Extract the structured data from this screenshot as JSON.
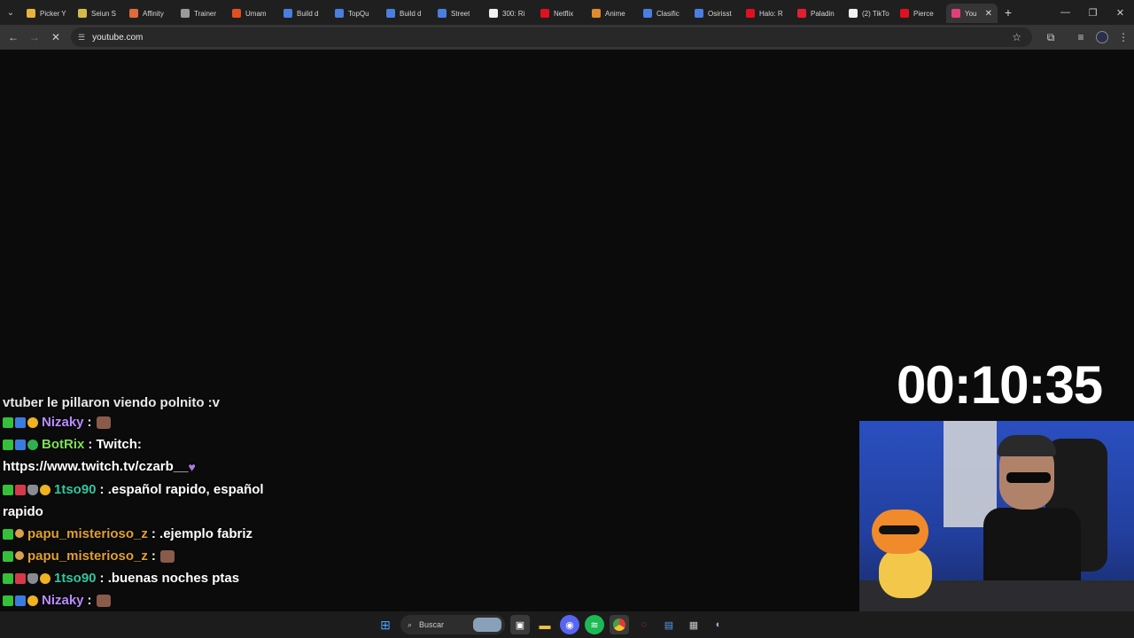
{
  "browser": {
    "tabs": [
      {
        "title": "Picker Y",
        "favicon_color": "#e9b23a"
      },
      {
        "title": "Seiun S",
        "favicon_color": "#d8b84a"
      },
      {
        "title": "Affinity",
        "favicon_color": "#e06a3a"
      },
      {
        "title": "Trainer",
        "favicon_color": "#9a9a9a"
      },
      {
        "title": "Umam",
        "favicon_color": "#e05020"
      },
      {
        "title": "Build d",
        "favicon_color": "#4a7ee0"
      },
      {
        "title": "TopQu",
        "favicon_color": "#4a7ee0"
      },
      {
        "title": "Build d",
        "favicon_color": "#4a7ee0"
      },
      {
        "title": "Street",
        "favicon_color": "#4a7ee0"
      },
      {
        "title": "300: Ri",
        "favicon_color": "#f0f0f0"
      },
      {
        "title": "Netflix",
        "favicon_color": "#e01020"
      },
      {
        "title": "Anime",
        "favicon_color": "#e08a30"
      },
      {
        "title": "Clasific",
        "favicon_color": "#4a7ee0"
      },
      {
        "title": "Osirisst",
        "favicon_color": "#4a7ee0"
      },
      {
        "title": "Halo: R",
        "favicon_color": "#e01020"
      },
      {
        "title": "Paladin",
        "favicon_color": "#e02030"
      },
      {
        "title": "(2) TikTo",
        "favicon_color": "#f0f0f0"
      },
      {
        "title": "Pierce",
        "favicon_color": "#e01020"
      },
      {
        "title": "You",
        "favicon_color": "#e0407a",
        "active": true
      }
    ],
    "new_tab_icon": "+",
    "url": "youtube.com"
  },
  "stream_overlay": {
    "timer": "00:10:35",
    "chat_cutoff_text": "vtuber le pillaron viendo polnito :v",
    "messages": [
      {
        "user": "Nizaky",
        "user_color": "#b98cff",
        "text": ":",
        "emote": "face"
      },
      {
        "user": "BotRix",
        "user_color": "#7ee05a",
        "text": ": Twitch:",
        "continuation": "https://www.twitch.tv/czarb__",
        "emote": "purple-heart"
      },
      {
        "user": "1tso90",
        "user_color": "#32c7a0",
        "text": ": .español rapido, español",
        "continuation": "rapido"
      },
      {
        "user": "papu_misterioso_z",
        "user_color": "#e0a030",
        "text": ": .ejemplo fabriz"
      },
      {
        "user": "papu_misterioso_z",
        "user_color": "#e0a030",
        "text": ":",
        "emote": "face"
      },
      {
        "user": "1tso90",
        "user_color": "#32c7a0",
        "text": ": .buenas noches ptas"
      },
      {
        "user": "Nizaky",
        "user_color": "#b98cff",
        "text": ":",
        "emote": "face"
      }
    ]
  },
  "taskbar": {
    "search_label": "Buscar"
  }
}
